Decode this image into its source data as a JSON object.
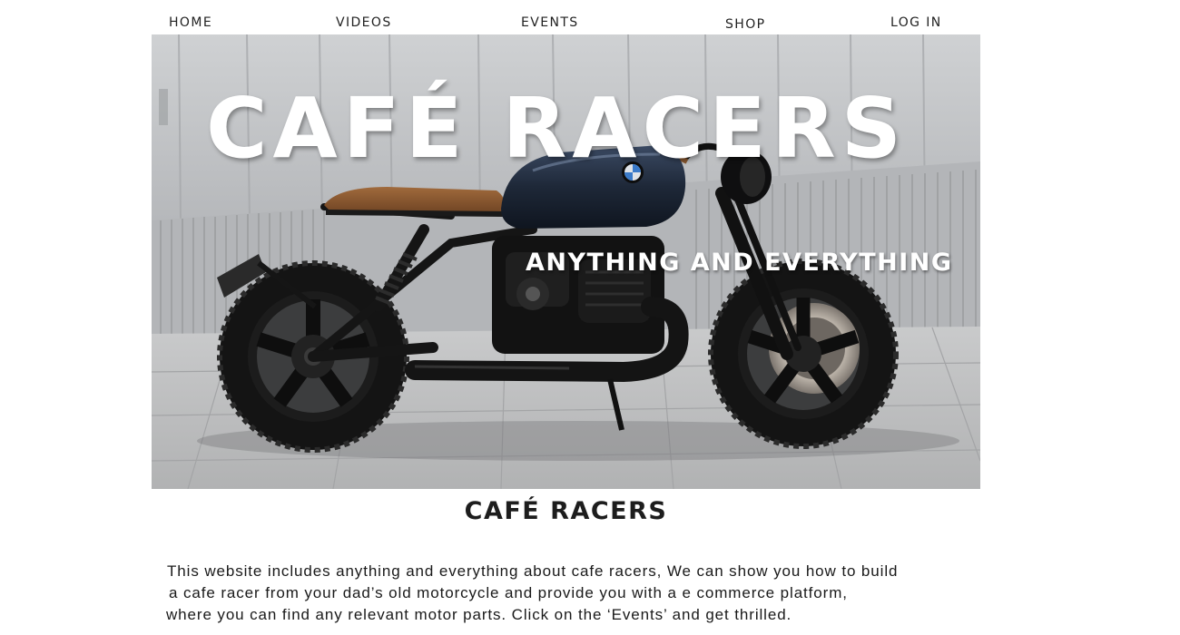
{
  "nav": {
    "items": [
      {
        "label": "HOME"
      },
      {
        "label": "VIDEOS"
      },
      {
        "label": "EVENTS"
      },
      {
        "label": "SHOP"
      },
      {
        "label": "LOG IN"
      }
    ]
  },
  "hero": {
    "title": "CAFÉ RACERS",
    "subtitle": "ANYTHING AND EVERYTHING",
    "image_subject": "black BMW cafe racer motorcycle"
  },
  "section": {
    "title": "CAFÉ RACERS"
  },
  "intro": {
    "lines": [
      "This website includes anything and everything about cafe racers, We can show you how to build",
      "a cafe racer from your dad’s old motorcycle and provide you with a e commerce platform,",
      "where you can find any relevant motor parts. Click on the ‘Events’ and get thrilled."
    ]
  },
  "colors": {
    "background": "#ffffff",
    "text": "#1a1a1a",
    "hero_text": "#ffffff",
    "tank": "#1f2a3a",
    "seat": "#8b5a32"
  }
}
